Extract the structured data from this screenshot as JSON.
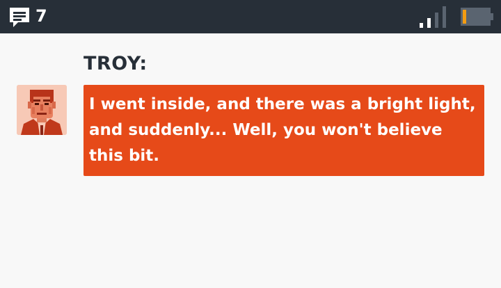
{
  "status_bar": {
    "message_count": "7",
    "message_icon": "chat-bubble-icon",
    "signal_icon": "signal-strength-icon",
    "battery_icon": "battery-low-icon",
    "battery_fill_fraction": 0.15,
    "signal_bars_active": 2,
    "signal_bars_total": 4
  },
  "dialog": {
    "speaker": "TROY:",
    "text": "I went inside, and there was a bright light, and suddenly... Well, you won't believe this bit.",
    "portrait_icon": "troy-portrait-icon"
  },
  "colors": {
    "status_bar_bg": "#272f38",
    "page_bg": "#f8f8f8",
    "bubble_bg": "#e64a19",
    "battery_level": "#f39c12"
  }
}
